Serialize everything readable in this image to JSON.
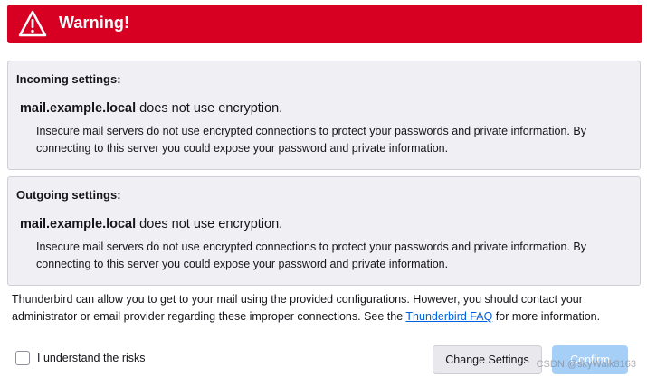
{
  "banner": {
    "title": "Warning!",
    "icon": "warning-triangle-icon",
    "color": "#d70022"
  },
  "incoming": {
    "title": "Incoming settings:",
    "host": "mail.example.local",
    "host_suffix": " does not use encryption.",
    "description": "Insecure mail servers do not use encrypted connections to protect your passwords and private information. By connecting to this server you could expose your password and private information."
  },
  "outgoing": {
    "title": "Outgoing settings:",
    "host": "mail.example.local",
    "host_suffix": " does not use encryption.",
    "description": "Insecure mail servers do not use encrypted connections to protect your passwords and private information. By connecting to this server you could expose your password and private information."
  },
  "footer": {
    "text_before": "Thunderbird can allow you to get to your mail using the provided configurations. However, you should contact your administrator or email provider regarding these improper connections. See the ",
    "link_label": "Thunderbird FAQ",
    "text_after": " for more information."
  },
  "risk": {
    "label": "I understand the risks",
    "checked": false
  },
  "buttons": {
    "change_settings": "Change Settings",
    "confirm": "Confirm"
  },
  "watermark": "CSDN @skyWalk8163"
}
